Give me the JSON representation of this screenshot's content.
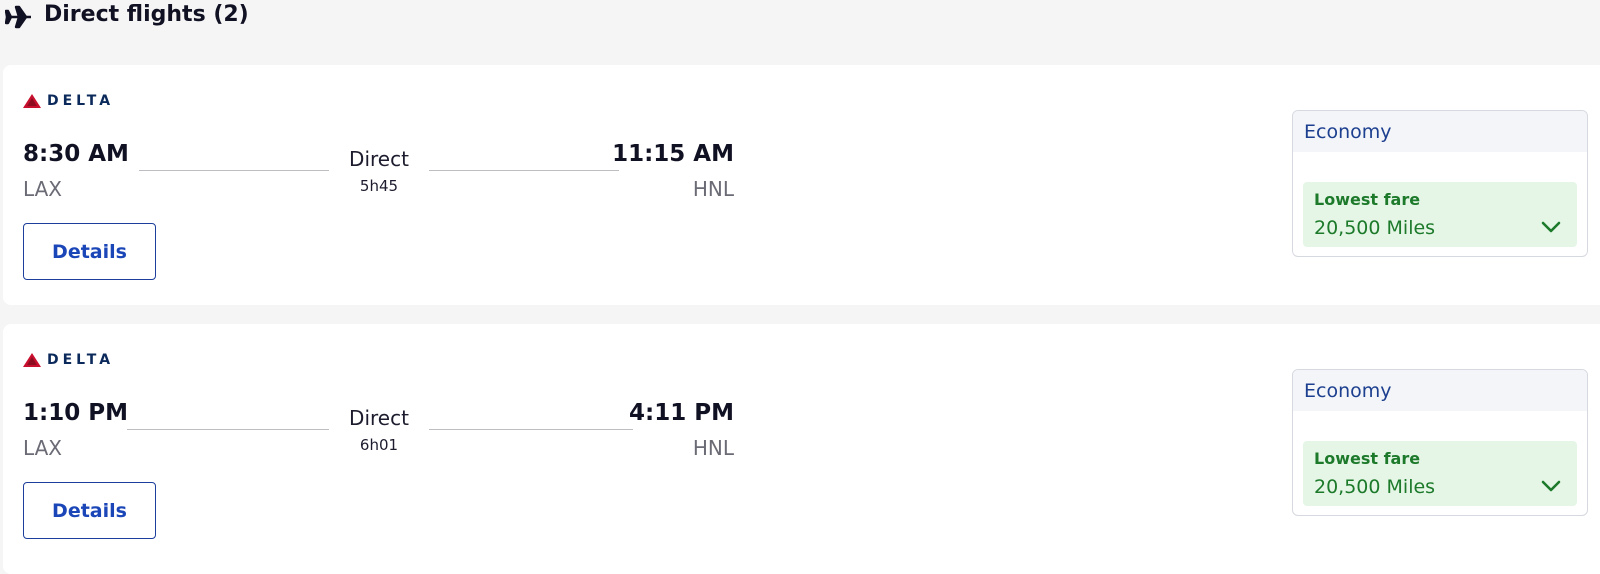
{
  "section": {
    "title": "Direct flights (2)",
    "icon": "airplane-icon"
  },
  "flights": [
    {
      "airline": "DELTA",
      "departure_time": "8:30 AM",
      "departure_code": "LAX",
      "stops": "Direct",
      "duration": "5h45",
      "arrival_time": "11:15 AM",
      "arrival_code": "HNL",
      "details_label": "Details",
      "cabin": "Economy",
      "fare_label": "Lowest fare",
      "fare_value": "20,500 Miles"
    },
    {
      "airline": "DELTA",
      "departure_time": "1:10 PM",
      "departure_code": "LAX",
      "stops": "Direct",
      "duration": "6h01",
      "arrival_time": "4:11 PM",
      "arrival_code": "HNL",
      "details_label": "Details",
      "cabin": "Economy",
      "fare_label": "Lowest fare",
      "fare_value": "20,500 Miles"
    }
  ],
  "colors": {
    "brand_red": "#c8102e",
    "brand_navy": "#0b2a5b",
    "link_blue": "#1b46b8",
    "fare_green": "#1d7a2b",
    "fare_bg": "#e5f6e6"
  }
}
